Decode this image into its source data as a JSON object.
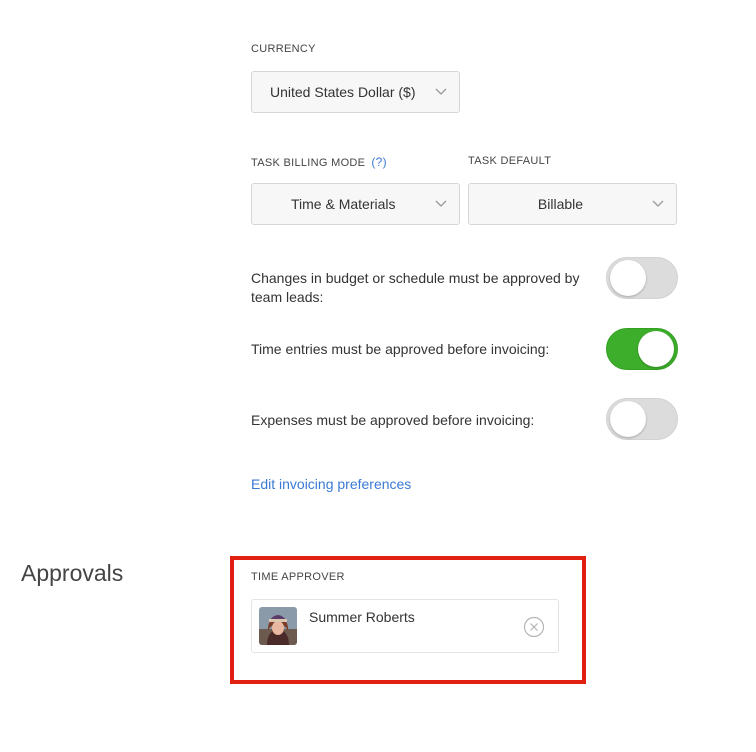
{
  "currency": {
    "label": "CURRENCY",
    "value": "United States Dollar ($)"
  },
  "billing": {
    "mode_label": "TASK BILLING MODE",
    "help_text": "(?)",
    "mode_value": "Time & Materials",
    "default_label": "TASK DEFAULT",
    "default_value": "Billable"
  },
  "toggles": [
    {
      "text": "Changes in budget or schedule must be approved by team leads:",
      "on": false
    },
    {
      "text": "Time entries must be approved before invoicing:",
      "on": true
    },
    {
      "text": "Expenses must be approved before invoicing:",
      "on": false
    }
  ],
  "invoicing_link": "Edit invoicing preferences",
  "approvals": {
    "title": "Approvals",
    "approver_label": "TIME APPROVER",
    "approver_name": "Summer Roberts"
  },
  "colors": {
    "toggle_on": "#3dae2b",
    "toggle_off": "#dcdcdc",
    "link": "#3a7bd5",
    "highlight": "#e02010"
  }
}
